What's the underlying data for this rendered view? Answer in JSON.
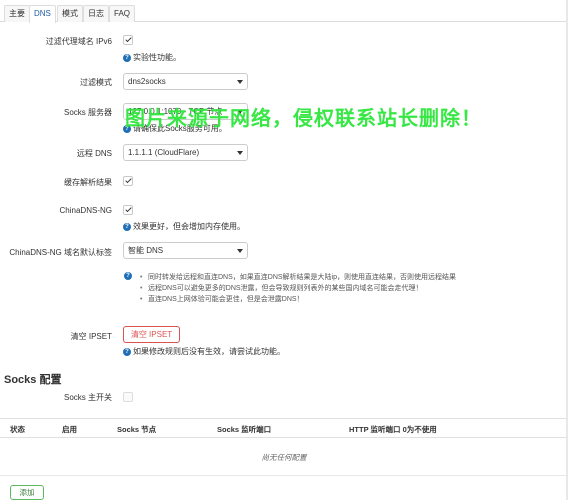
{
  "tabs": [
    "主要",
    "DNS",
    "模式",
    "日志",
    "FAQ"
  ],
  "active_tab": "DNS",
  "form": {
    "filter_ipv6": {
      "label": "过滤代理域名 IPv6",
      "checked": true,
      "help": "实验性功能。"
    },
    "filter_mode": {
      "label": "过滤模式",
      "value": "dns2socks"
    },
    "socks_server": {
      "label": "Socks 服务器",
      "value": "127.0.0.1:1070 - TCP 节点",
      "help": "请确保此Socks服务可用。"
    },
    "remote_dns": {
      "label": "远程 DNS",
      "value": "1.1.1.1 (CloudFlare)"
    },
    "cache": {
      "label": "缓存解析结果",
      "checked": true
    },
    "chinadns_ng": {
      "label": "ChinaDNS-NG",
      "checked": true,
      "help": "效果更好，但会增加内存使用。"
    },
    "chinadns_default_tag": {
      "label": "ChinaDNS-NG 域名默认标签",
      "value": "智能 DNS"
    },
    "info": [
      "同时转发给远程和直连DNS，如果直连DNS解析结果是大陆ip，则使用直连结果，否则使用远程结果",
      "远程DNS可以避免更多的DNS泄露，但会导致规则列表外的某些国内域名可能会走代理！",
      "直连DNS上网体验可能会更佳，但是会泄露DNS！"
    ],
    "clear_ipset": {
      "label": "清空 IPSET",
      "button": "清空 IPSET",
      "help": "如果修改规则后没有生效，请尝试此功能。"
    }
  },
  "socks_section": {
    "title": "Socks 配置",
    "master_switch_label": "Socks 主开关",
    "master_switch_checked": false,
    "columns": [
      "状态",
      "启用",
      "Socks 节点",
      "Socks 监听端口",
      "HTTP 监听端口 0为不使用"
    ],
    "empty_text": "尚无任何配置",
    "add_button": "添加"
  },
  "watermark": "图片来源于网络，侵权联系站长删除！",
  "colors": {
    "accent": "#1f6fb6",
    "danger": "#d9534f",
    "success": "#5cb85c",
    "watermark": "#2ee63c"
  }
}
